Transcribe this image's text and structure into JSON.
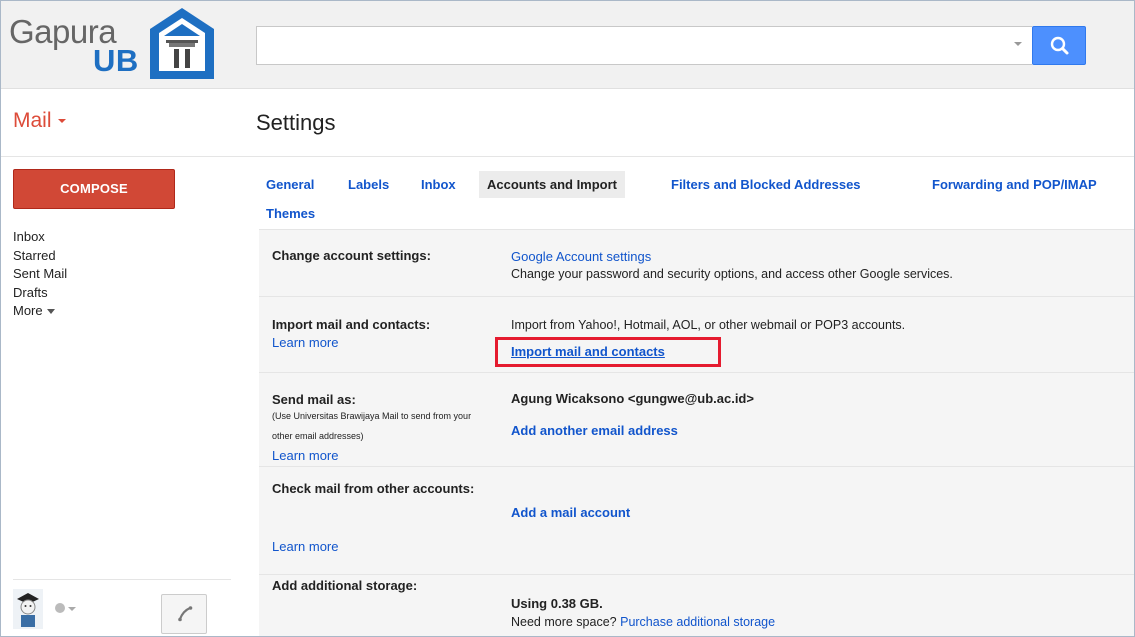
{
  "colors": {
    "accent_red": "#dd4b39",
    "compose_red": "#d14836",
    "link_blue": "#1155cc",
    "search_blue": "#4d90fe",
    "brand_blue": "#1e6fc2",
    "highlight_red": "#e51b2f"
  },
  "header": {
    "logo_text_1": "Gapura",
    "logo_text_2": "UB",
    "search": {
      "placeholder": "",
      "icon": "search-icon"
    }
  },
  "app": {
    "label": "Mail"
  },
  "page": {
    "title": "Settings"
  },
  "sidebar": {
    "compose_label": "COMPOSE",
    "items": [
      {
        "label": "Inbox"
      },
      {
        "label": "Starred"
      },
      {
        "label": "Sent Mail"
      },
      {
        "label": "Drafts"
      },
      {
        "label": "More"
      }
    ]
  },
  "tabs": [
    {
      "label": "General"
    },
    {
      "label": "Labels"
    },
    {
      "label": "Inbox"
    },
    {
      "label": "Accounts and Import",
      "active": true
    },
    {
      "label": "Filters and Blocked Addresses"
    },
    {
      "label": "Forwarding and POP/IMAP"
    },
    {
      "label": "Themes"
    }
  ],
  "settings": {
    "change_account": {
      "label": "Change account settings:",
      "link": "Google Account settings",
      "desc": "Change your password and security options, and access other Google services."
    },
    "import": {
      "label": "Import mail and contacts:",
      "learn_more": "Learn more",
      "desc": "Import from Yahoo!, Hotmail, AOL, or other webmail or POP3 accounts.",
      "action": "Import mail and contacts"
    },
    "send_as": {
      "label": "Send mail as:",
      "note": "(Use Universitas Brawijaya Mail to send from your other email addresses)",
      "learn_more": "Learn more",
      "address": "Agung Wicaksono <gungwe@ub.ac.id>",
      "action": "Add another email address"
    },
    "check_mail": {
      "label": "Check mail from other accounts:",
      "learn_more": "Learn more",
      "action": "Add a mail account"
    },
    "storage": {
      "label": "Add additional storage:",
      "usage": "Using 0.38 GB.",
      "prompt": "Need more space?",
      "link": "Purchase additional storage"
    }
  }
}
